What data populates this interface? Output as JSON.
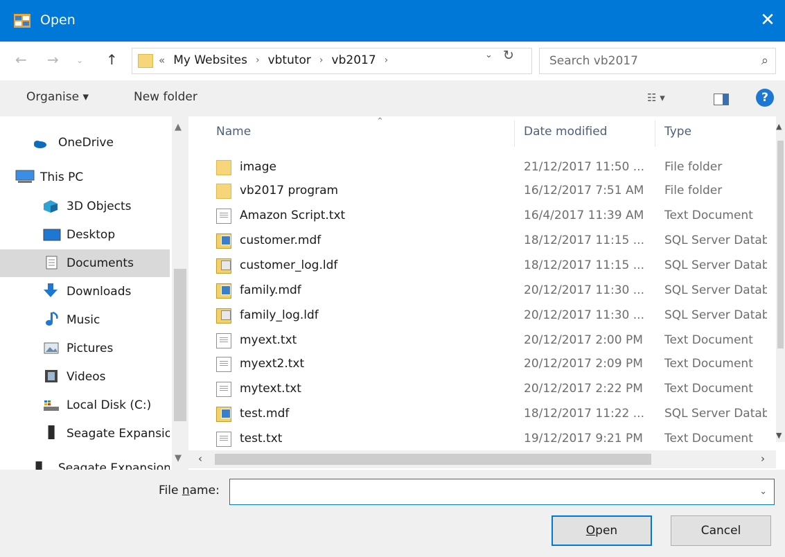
{
  "window": {
    "title": "Open"
  },
  "address": {
    "overflow": "«",
    "crumbs": [
      "My Websites",
      "vbtutor",
      "vb2017"
    ],
    "search_placeholder": "Search vb2017"
  },
  "toolbar": {
    "organise": "Organise ▾",
    "new_folder": "New folder"
  },
  "sidebar": {
    "items": [
      {
        "label": "OneDrive",
        "icon": "onedrive-cloud-icon"
      },
      {
        "label": "This PC",
        "icon": "computer-icon"
      },
      {
        "label": "3D Objects",
        "icon": "3d-objects-icon"
      },
      {
        "label": "Desktop",
        "icon": "desktop-icon"
      },
      {
        "label": "Documents",
        "icon": "documents-icon",
        "selected": true
      },
      {
        "label": "Downloads",
        "icon": "downloads-arrow-icon"
      },
      {
        "label": "Music",
        "icon": "music-note-icon"
      },
      {
        "label": "Pictures",
        "icon": "pictures-icon"
      },
      {
        "label": "Videos",
        "icon": "videos-film-icon"
      },
      {
        "label": "Local Disk (C:)",
        "icon": "drive-icon"
      },
      {
        "label": "Seagate Expansion",
        "icon": "external-drive-icon"
      },
      {
        "label": "Seagate Expansion",
        "icon": "external-drive-icon"
      }
    ]
  },
  "columns": {
    "name": "Name",
    "date": "Date modified",
    "type": "Type"
  },
  "files": [
    {
      "name": "image",
      "date": "21/12/2017 11:50 ...",
      "type": "File folder",
      "icon": "folder-icon"
    },
    {
      "name": "vb2017 program",
      "date": "16/12/2017 7:51 AM",
      "type": "File folder",
      "icon": "folder-icon"
    },
    {
      "name": "Amazon Script.txt",
      "date": "16/4/2017 11:39 AM",
      "type": "Text Document",
      "icon": "text-file-icon"
    },
    {
      "name": "customer.mdf",
      "date": "18/12/2017 11:15 ...",
      "type": "SQL Server Database",
      "icon": "sql-database-icon"
    },
    {
      "name": "customer_log.ldf",
      "date": "18/12/2017 11:15 ...",
      "type": "SQL Server Database",
      "icon": "sql-log-icon"
    },
    {
      "name": "family.mdf",
      "date": "20/12/2017 11:30 ...",
      "type": "SQL Server Database",
      "icon": "sql-database-icon"
    },
    {
      "name": "family_log.ldf",
      "date": "20/12/2017 11:30 ...",
      "type": "SQL Server Database",
      "icon": "sql-log-icon"
    },
    {
      "name": "myext.txt",
      "date": "20/12/2017 2:00 PM",
      "type": "Text Document",
      "icon": "text-file-icon"
    },
    {
      "name": "myext2.txt",
      "date": "20/12/2017 2:09 PM",
      "type": "Text Document",
      "icon": "text-file-icon"
    },
    {
      "name": "mytext.txt",
      "date": "20/12/2017 2:22 PM",
      "type": "Text Document",
      "icon": "text-file-icon"
    },
    {
      "name": "test.mdf",
      "date": "18/12/2017 11:22 ...",
      "type": "SQL Server Database",
      "icon": "sql-database-icon"
    },
    {
      "name": "test.txt",
      "date": "19/12/2017 9:21 PM",
      "type": "Text Document",
      "icon": "text-file-icon"
    }
  ],
  "footer": {
    "filename_label_prefix": "File ",
    "filename_label_accel": "n",
    "filename_label_suffix": "ame:",
    "filename_value": "",
    "open_accel": "O",
    "open_rest": "pen",
    "cancel": "Cancel"
  }
}
